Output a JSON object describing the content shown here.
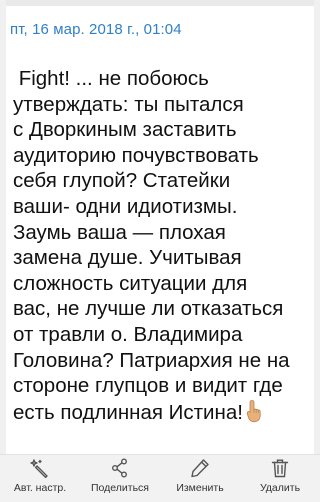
{
  "message": {
    "timestamp": "пт, 16 мар. 2018 г., 01:04",
    "body": " Fight! ... не побоюсь\nутверждать: ты пытался\nс Дворкиным заставить\nаудиторию почувствовать\nсебя глупой? Статейки\nваши- одни идиотизмы.\nЗаумь ваша — плохая\nзамена душе. Учитывая\nсложность ситуации для\nвас, не лучше ли отказаться\nот травли о. Владимира\nГоловина? Патриархия не на\nстороне глупцов и видит где\nесть подлинная Истина!",
    "trailing_emoji_icon": "pointing-up-finger-icon"
  },
  "toolbar": {
    "buttons": [
      {
        "label": "Авт. настр.",
        "icon": "magic-wand-icon"
      },
      {
        "label": "Поделиться",
        "icon": "share-icon"
      },
      {
        "label": "Изменить",
        "icon": "pencil-icon"
      },
      {
        "label": "Удалить",
        "icon": "trash-icon"
      }
    ]
  },
  "colors": {
    "timestamp": "#2f80c8",
    "text": "#111111",
    "toolbar_bg": "#f2f2f2",
    "icon": "#555555",
    "emoji": "#e8b07a"
  }
}
